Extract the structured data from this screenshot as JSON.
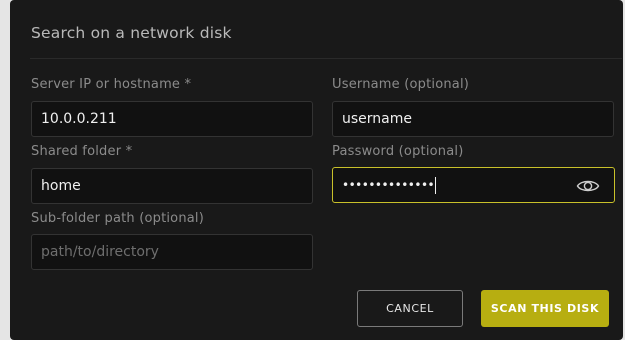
{
  "dialog": {
    "title": "Search on a network disk"
  },
  "fields": {
    "server": {
      "label": "Server IP or hostname *",
      "value": "10.0.0.211",
      "placeholder": ""
    },
    "username": {
      "label": "Username (optional)",
      "value": "username",
      "placeholder": ""
    },
    "shared_folder": {
      "label": "Shared folder *",
      "value": "home",
      "placeholder": ""
    },
    "password": {
      "label": "Password (optional)",
      "masked_value": "••••••••••••••",
      "toggle_icon": "eye-icon"
    },
    "subfolder": {
      "label": "Sub-folder path (optional)",
      "value": "",
      "placeholder": "path/to/directory"
    }
  },
  "actions": {
    "cancel_label": "CANCEL",
    "scan_label": "SCAN THIS DISK"
  },
  "colors": {
    "dialog_background": "#191919",
    "accent": "#b7ae11",
    "focus_border": "#c9c12a"
  }
}
